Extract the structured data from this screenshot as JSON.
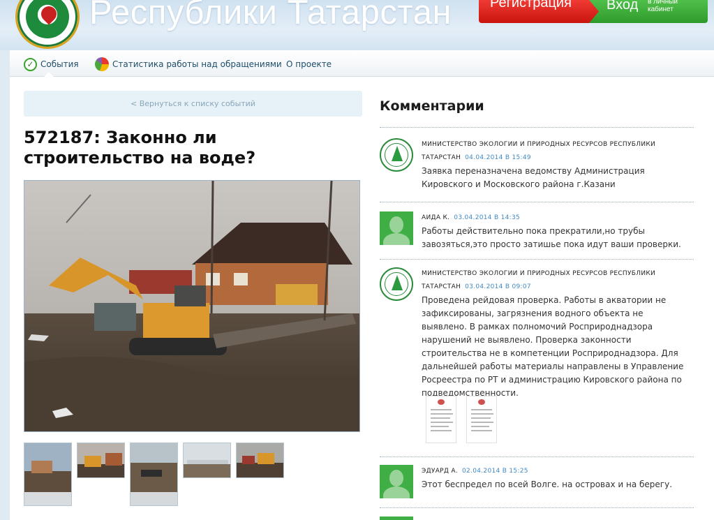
{
  "header": {
    "site_title": "Республики Татарстан",
    "register_label": "Регистрация",
    "login_label": "Вход",
    "login_sub": "в личный кабинет"
  },
  "nav": {
    "items": [
      {
        "label": "События",
        "icon": "check-circle-icon",
        "active": true
      },
      {
        "label": "Статистика работы над обращениями",
        "icon": "pie-chart-icon"
      },
      {
        "label": "О проекте"
      }
    ]
  },
  "event": {
    "back_label": "< Вернуться к списку событий",
    "title": "572187: Законно ли строительство на воде?"
  },
  "comments": {
    "title": "Комментарии",
    "items": [
      {
        "author": "МИНИСТЕРСТВО ЭКОЛОГИИ И ПРИРОДНЫХ РЕСУРСОВ РЕСПУБЛИКИ ТАТАРСТАН",
        "date": "04.04.2014 в 15:49",
        "avatar": "ministry-logo",
        "text": "Заявка переназначена ведомству Администрация Кировского и Московского района г.Казани"
      },
      {
        "author": "АИДА К.",
        "date": "03.04.2014 в 14:35",
        "avatar": "default-user",
        "text": "Работы действительно пока прекратили,но трубы завозяться,это просто затишье пока идут ваши проверки."
      },
      {
        "author": "МИНИСТЕРСТВО ЭКОЛОГИИ И ПРИРОДНЫХ РЕСУРСОВ РЕСПУБЛИКИ ТАТАРСТАН",
        "date": "03.04.2014 в 09:07",
        "avatar": "ministry-logo",
        "text": "Проведена рейдовая проверка. Работы в акватории не зафиксированы, загрязнения водного объекта не выявлено. В рамках полномочий Росприроднадзора нарушений не выявлено. Проверка законности строительства не в компетенции Росприроднадзора. Для дальнейшей работы материалы направлены в Управление Росреестра по РТ и администрацию Кировского района по подведомственности.",
        "attachments": 2
      },
      {
        "author": "ЭДУАРД А.",
        "date": "02.04.2014 в 15:25",
        "avatar": "default-user",
        "text": "Этот беспредел по всей Волге. на островах и на берегу."
      }
    ]
  },
  "colors": {
    "register": "#d9221b",
    "login": "#3fae3a",
    "link": "#3f88c4",
    "nav_text": "#1f4e6b"
  }
}
